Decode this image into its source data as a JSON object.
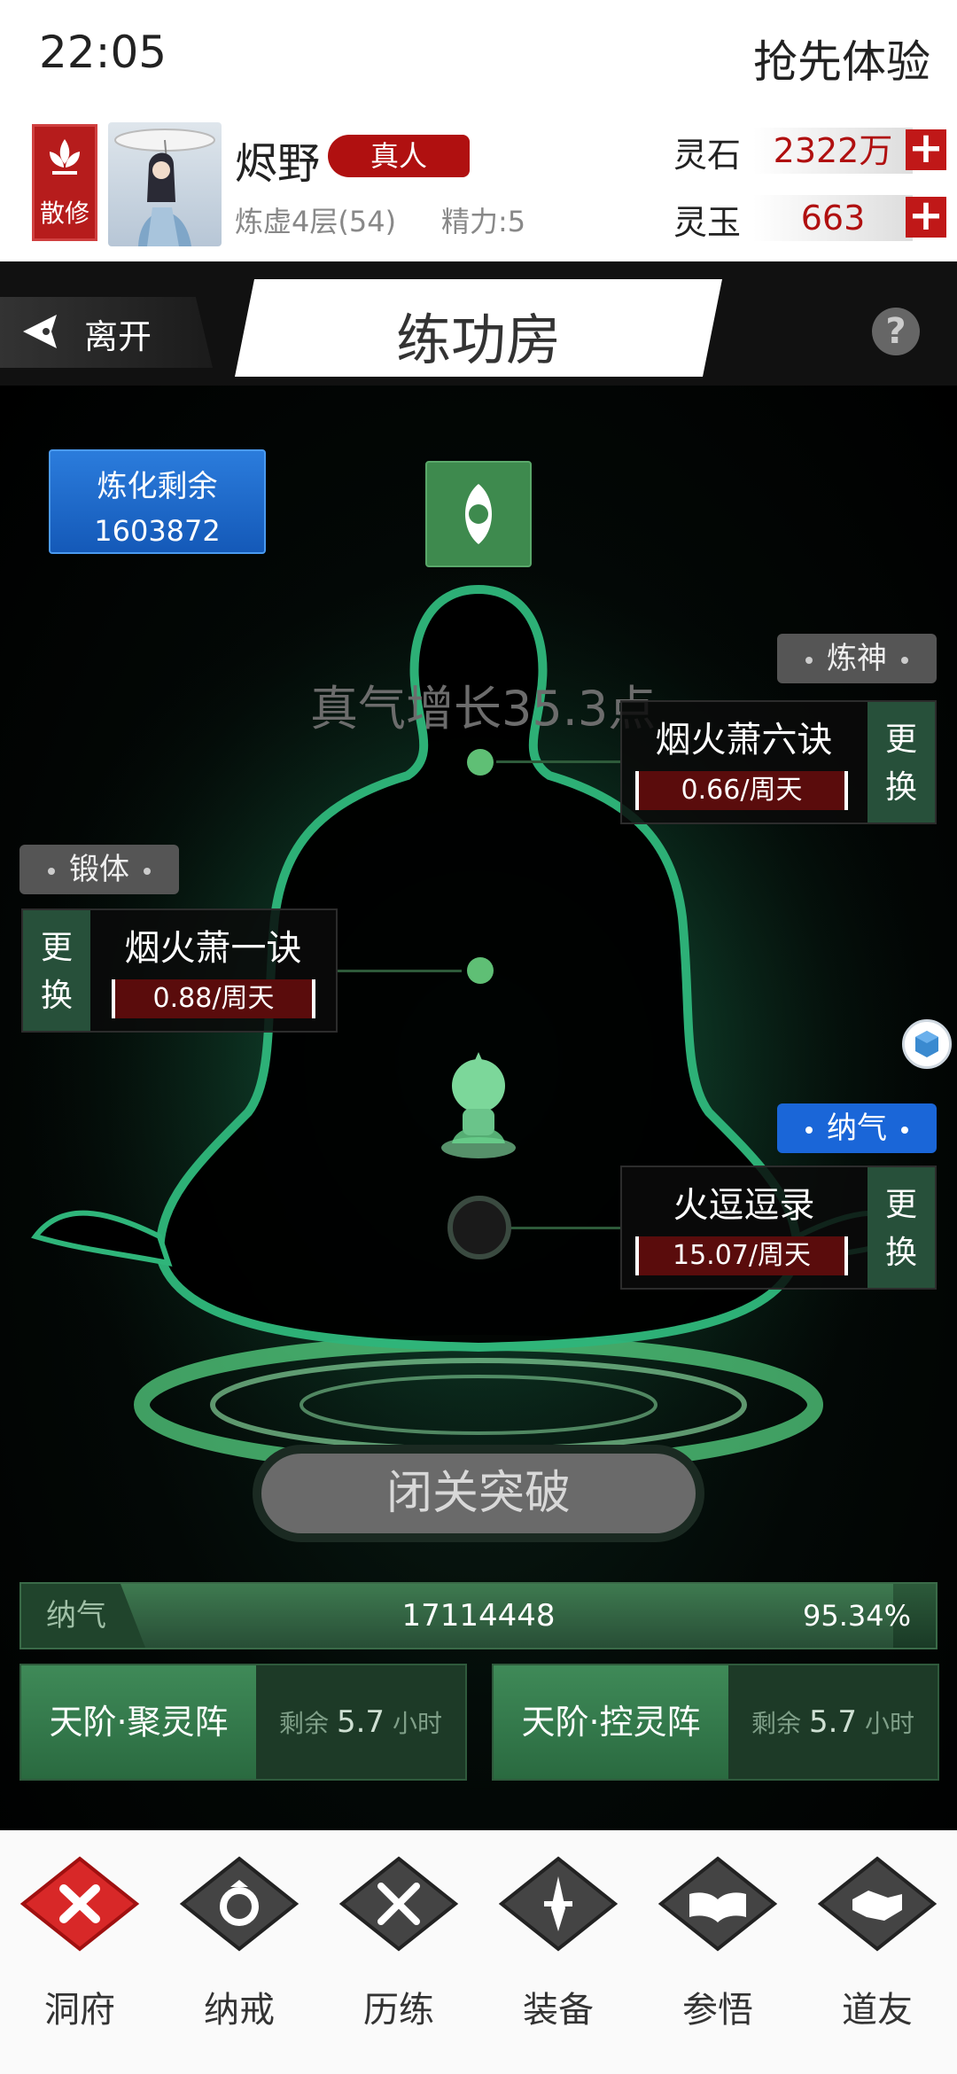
{
  "status_bar": {
    "time": "22:05",
    "promo": "抢先体验"
  },
  "profile": {
    "sect_badge": "散修",
    "name": "烬野",
    "rank": "真人",
    "realm": "炼虚4层(54)",
    "energy": "精力:5",
    "currencies": [
      {
        "label": "灵石",
        "value": "2322万"
      },
      {
        "label": "灵玉",
        "value": "663"
      }
    ]
  },
  "titlebar": {
    "back": "离开",
    "title": "练功房",
    "help": "?"
  },
  "scene": {
    "refine": {
      "label": "炼化剩余",
      "value": "1603872"
    },
    "qi_growth": "真气增长35.3点",
    "techniques": {
      "spirit": {
        "tag": "炼神",
        "name": "烟火萧六诀",
        "rate": "0.66/周天",
        "change_top": "更",
        "change_bottom": "换"
      },
      "body": {
        "tag": "锻体",
        "name": "烟火萧一诀",
        "rate": "0.88/周天",
        "change_top": "更",
        "change_bottom": "换"
      },
      "qi": {
        "tag": "纳气",
        "name": "火逗逗录",
        "rate": "15.07/周天",
        "change_top": "更",
        "change_bottom": "换"
      }
    },
    "breakthrough": "闭关突破",
    "qi_bar": {
      "label": "纳气",
      "value": "17114448",
      "percent": "95.34%",
      "fill_fraction": 0.9534
    },
    "arrays": [
      {
        "name": "天阶·聚灵阵",
        "remain_prefix": "剩余",
        "remain_value": "5.7",
        "remain_unit": "小时"
      },
      {
        "name": "天阶·控灵阵",
        "remain_prefix": "剩余",
        "remain_value": "5.7",
        "remain_unit": "小时"
      }
    ]
  },
  "bottom_nav": [
    {
      "label": "洞府",
      "icon": "close-x-icon"
    },
    {
      "label": "纳戒",
      "icon": "ring-icon"
    },
    {
      "label": "历练",
      "icon": "crossed-swords-icon"
    },
    {
      "label": "装备",
      "icon": "dagger-icon"
    },
    {
      "label": "参悟",
      "icon": "open-book-icon"
    },
    {
      "label": "道友",
      "icon": "handshake-icon"
    }
  ],
  "colors": {
    "accent_red": "#b01010",
    "scene_green": "#3e8a4e",
    "blue_button": "#1a66d8"
  }
}
